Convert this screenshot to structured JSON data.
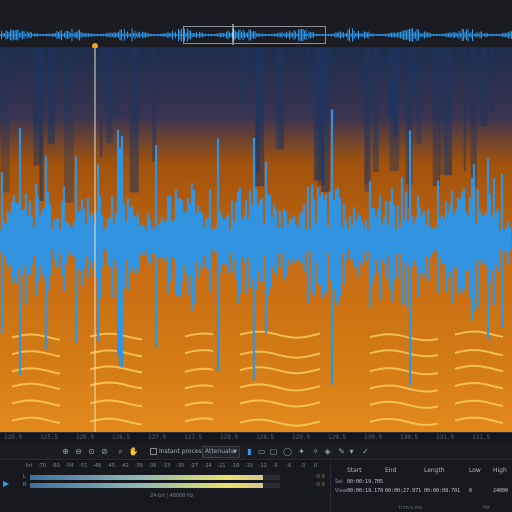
{
  "timeline": {
    "ticks": [
      "125.0",
      "125.5",
      "126.0",
      "126.5",
      "127.0",
      "127.5",
      "128.0",
      "128.5",
      "129.0",
      "129.5",
      "130.0",
      "130.5",
      "131.0",
      "131.5"
    ]
  },
  "toolbar": {
    "instant_process_label": "Instant process",
    "mode_value": "Attenuate"
  },
  "meter": {
    "scale": [
      "-Inf",
      "-70",
      "-60",
      "-54",
      "-51",
      "-48",
      "-45",
      "-42",
      "-39",
      "-36",
      "-33",
      "-30",
      "-27",
      "-24",
      "-21",
      "-18",
      "-15",
      "-12",
      "-9",
      "-6",
      "-3",
      "0"
    ],
    "left_label": "L",
    "right_label": "R",
    "left_level": 0.93,
    "right_level": 0.93,
    "left_peak": "-0.9",
    "right_peak": "-0.9",
    "format": "24-bit | 48000 Hz"
  },
  "selection": {
    "headers": {
      "start": "Start",
      "end": "End",
      "length": "Length",
      "low": "Low",
      "high": "High"
    },
    "sel_label": "Sel",
    "view_label": "View",
    "sel_start": "00:00:19.705",
    "view_start": "00:00:19.170",
    "view_end": "00:00:27.871",
    "view_length": "00:00:08.701",
    "view_low": "0",
    "view_high": "24000",
    "time_unit": "h:m:s.ms",
    "freq_unit": "Hz"
  },
  "colors": {
    "waveform": "#2c97ea",
    "spectro_low": "#1a2b4a",
    "spectro_mid": "#c8620a",
    "spectro_high": "#ffd25a",
    "playhead": "#f2a51c"
  }
}
